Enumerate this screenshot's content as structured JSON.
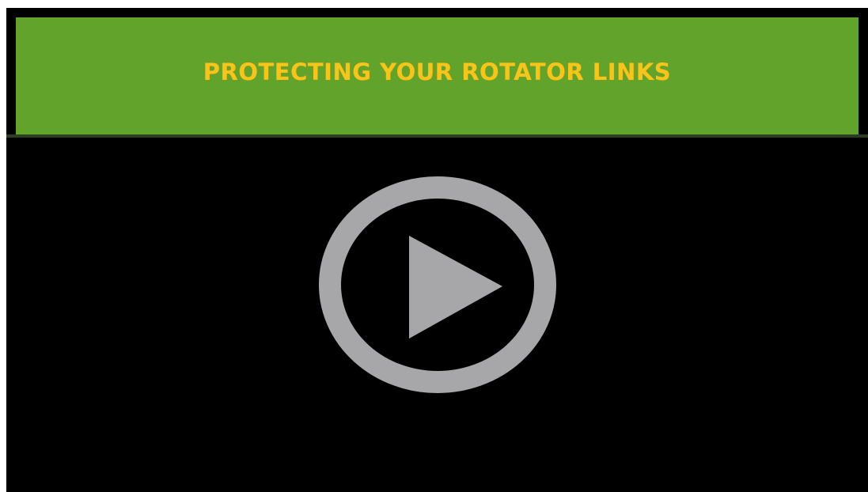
{
  "banner": {
    "title": "PROTECTING YOUR ROTATOR LINKS",
    "background_color": "#61a32b",
    "title_color": "#f7c41a"
  },
  "player": {
    "background_color": "#000000",
    "play_icon": "play-circle-icon",
    "icon_color": "#a7a6a8"
  }
}
